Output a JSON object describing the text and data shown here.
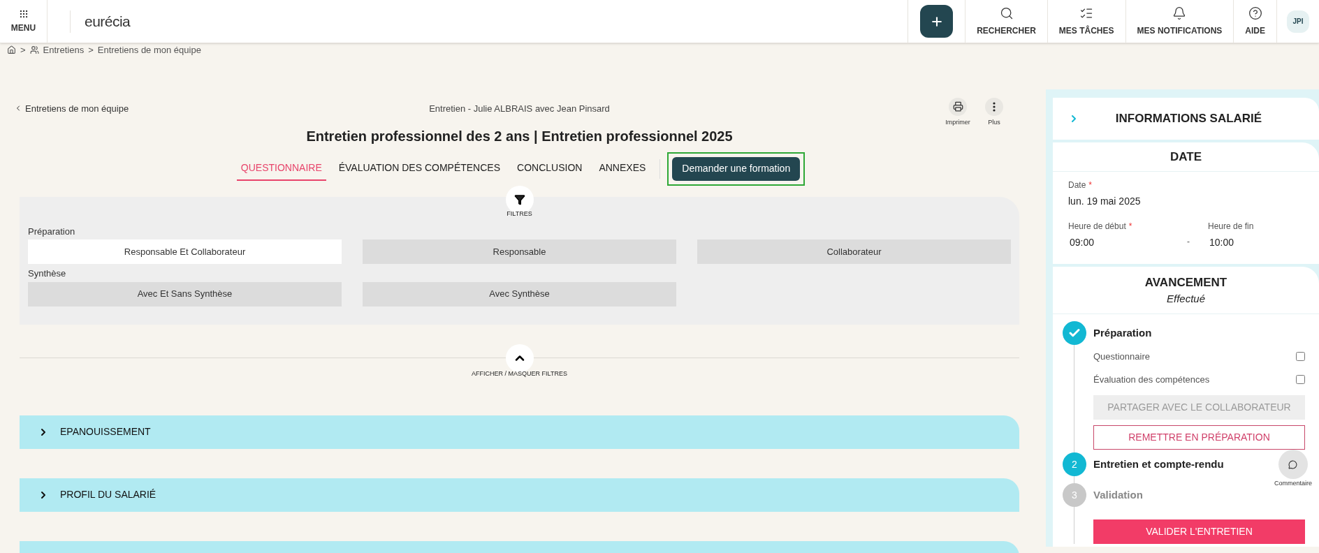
{
  "header": {
    "menu_label": "MENU",
    "logo": "eurécia",
    "nav": [
      {
        "kind": "search",
        "label": "RECHERCHER"
      },
      {
        "kind": "tasks",
        "label": "MES TÂCHES"
      },
      {
        "kind": "bell",
        "label": "MES NOTIFICATIONS"
      },
      {
        "kind": "help",
        "label": "AIDE"
      }
    ],
    "avatar": "JPI"
  },
  "breadcrumb": {
    "home_separator": ">",
    "items": [
      {
        "label": "Entretiens"
      },
      {
        "separator": ">",
        "label": "Entretiens de mon équipe"
      }
    ]
  },
  "back_link": "Entretiens de mon équipe",
  "subtitle": "Entretien - Julie ALBRAIS avec Jean Pinsard",
  "title": "Entretien professionnel des 2 ans | Entretien professionnel 2025",
  "actions": [
    {
      "kind": "print",
      "label": "Imprimer"
    },
    {
      "kind": "more",
      "label": "Plus"
    }
  ],
  "tabs": [
    {
      "label": "QUESTIONNAIRE",
      "selected": true
    },
    {
      "label": "ÉVALUATION DES COMPÉTENCES",
      "selected": false
    },
    {
      "label": "CONCLUSION",
      "selected": false
    },
    {
      "label": "ANNEXES",
      "selected": false
    }
  ],
  "request_button": {
    "label": "Demander une formation",
    "highlighted": true
  },
  "filters": {
    "label": "FILTRES",
    "groups": [
      {
        "label": "Préparation",
        "options": [
          {
            "label": "Responsable Et Collaborateur",
            "selected": true
          },
          {
            "label": "Responsable",
            "selected": false
          },
          {
            "label": "Collaborateur",
            "selected": false
          }
        ]
      },
      {
        "label": "Synthèse",
        "options": [
          {
            "label": "Avec Et Sans Synthèse",
            "selected": false
          },
          {
            "label": "Avec Synthèse",
            "selected": false
          }
        ]
      }
    ],
    "toggle_label": "AFFICHER / MASQUER FILTRES"
  },
  "sections": [
    {
      "kind": "header",
      "label": "EPANOUISSEMENT",
      "expanded": false
    },
    {
      "kind": "header",
      "label": "PROFIL DU SALARIÉ",
      "expanded": false
    },
    {
      "kind": "partial"
    }
  ],
  "side_panel": {
    "title": "INFORMATIONS SALARIÉ",
    "date_card": {
      "title": "DATE",
      "date_label": "Date",
      "date_required": "*",
      "date_value": "lun. 19 mai 2025",
      "start_label": "Heure de début",
      "start_required": "*",
      "start_value": "09:00",
      "separator": "-",
      "end_label": "Heure de fin",
      "end_value": "10:00"
    },
    "progress": {
      "title": "AVANCEMENT",
      "status": "Effectué",
      "steps": [
        {
          "kind": "done",
          "label": "Préparation",
          "items": [
            {
              "label": "Questionnaire",
              "checked": false
            },
            {
              "label": "Évaluation des compétences",
              "checked": false
            }
          ],
          "buttons": [
            {
              "kind": "neutral",
              "label": "PARTAGER AVEC LE COLLABORATEUR",
              "disabled": true
            },
            {
              "kind": "outline",
              "label": "REMETTRE EN PRÉPARATION",
              "disabled": false
            }
          ]
        },
        {
          "kind": "current",
          "number": "2",
          "label": "Entretien et compte-rendu",
          "comment_label": "Commentaire"
        },
        {
          "kind": "todo",
          "number": "3",
          "label": "Validation",
          "buttons": [
            {
              "kind": "primary",
              "label": "VALIDER L'ENTRETIEN",
              "disabled": false
            }
          ]
        }
      ]
    }
  }
}
